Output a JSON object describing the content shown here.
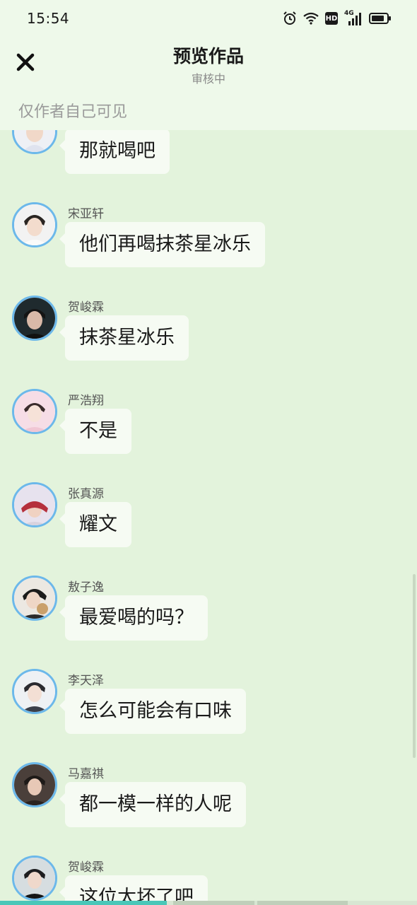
{
  "status_bar": {
    "time": "15:54",
    "hd_label": "HD",
    "network_label": "4G"
  },
  "header": {
    "title": "预览作品",
    "subtitle": "审核中",
    "visibility_note": "仅作者自己可见"
  },
  "messages": [
    {
      "name": "",
      "text": "那就喝吧"
    },
    {
      "name": "宋亚轩",
      "text": "他们再喝抹茶星冰乐"
    },
    {
      "name": "贺峻霖",
      "text": "抹茶星冰乐"
    },
    {
      "name": "严浩翔",
      "text": "不是"
    },
    {
      "name": "张真源",
      "text": "耀文"
    },
    {
      "name": "敖子逸",
      "text": "最爱喝的吗？"
    },
    {
      "name": "李天泽",
      "text": "怎么可能会有口味"
    },
    {
      "name": "马嘉祺",
      "text": "都一模一样的人呢"
    },
    {
      "name": "贺峻霖",
      "text": "这位太坏了吧"
    }
  ],
  "playback_progress": 0.4,
  "colors": {
    "header_bg": "#eef9ea",
    "chat_bg": "#e3f3dc",
    "bubble_bg": "#f6fbf3",
    "avatar_ring": "#6cb8ea",
    "progress_fill": "#49c7b8"
  }
}
